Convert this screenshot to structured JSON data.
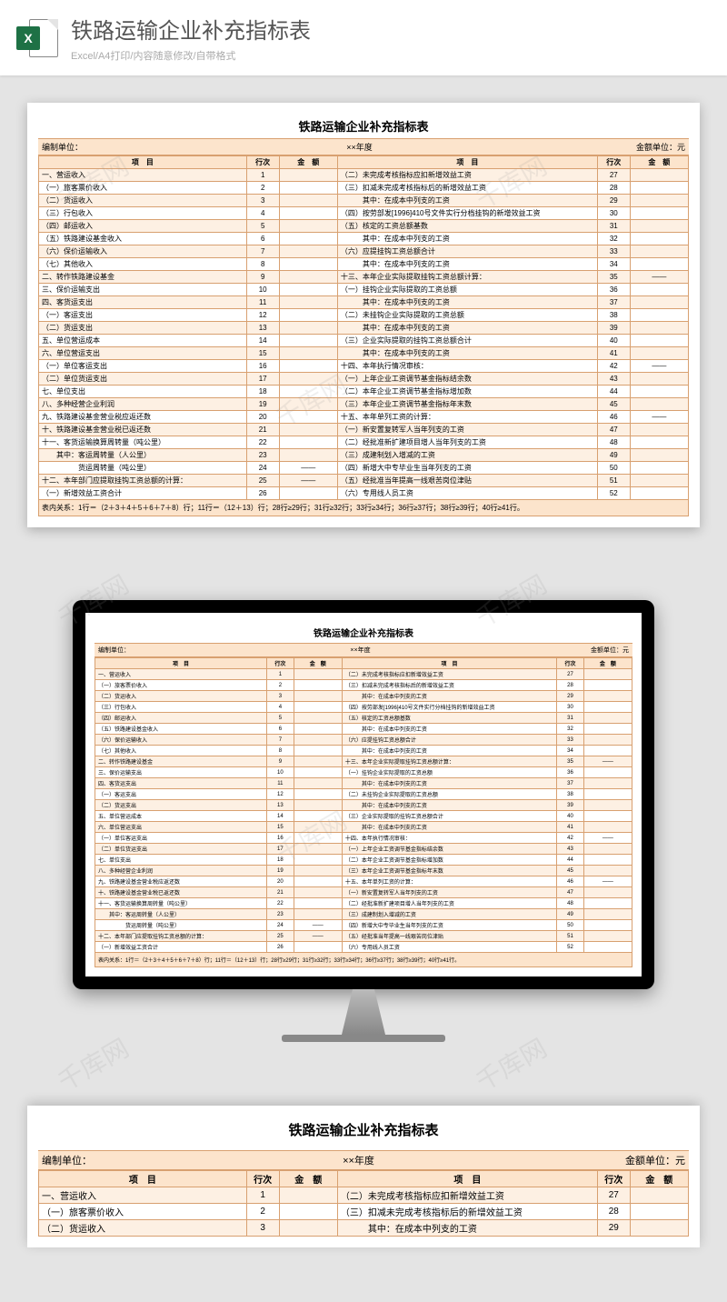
{
  "header": {
    "title": "铁路运输企业补充指标表",
    "subtitle": "Excel/A4打印/内容随意修改/自带格式",
    "icon_letter": "X"
  },
  "sheet": {
    "title": "铁路运输企业补充指标表",
    "meta_left": "编制单位：",
    "meta_mid": "××年度",
    "meta_right": "金额单位：元",
    "col_project": "项　目",
    "col_row": "行次",
    "col_amount": "金　额",
    "note": "表内关系：1行＝（2＋3＋4＋5＋6＋7＋8）行；11行＝（12＋13）行；28行≥29行；31行≥32行；33行≥34行；36行≥37行；38行≥39行；40行≥41行。"
  },
  "rows": [
    {
      "l": "一、营运收入",
      "ln": "1",
      "r": "（二）未完成考核指标应扣新增效益工资",
      "rn": "27"
    },
    {
      "l": "（一）旅客票价收入",
      "ln": "2",
      "r": "（三）扣减未完成考核指标后的新增效益工资",
      "rn": "28"
    },
    {
      "l": "（二）货运收入",
      "ln": "3",
      "r": "　　　其中：在成本中列支的工资",
      "rn": "29"
    },
    {
      "l": "（三）行包收入",
      "ln": "4",
      "r": "（四）按劳部发[1996]410号文件实行分档挂钩的新增效益工资",
      "rn": "30"
    },
    {
      "l": "（四）邮运收入",
      "ln": "5",
      "r": "（五）核定的工资总额基数",
      "rn": "31"
    },
    {
      "l": "（五）铁路建设基金收入",
      "ln": "6",
      "r": "　　　其中：在成本中列支的工资",
      "rn": "32"
    },
    {
      "l": "（六）保价运输收入",
      "ln": "7",
      "r": "（六）应提挂钩工资总额合计",
      "rn": "33"
    },
    {
      "l": "（七）其他收入",
      "ln": "8",
      "r": "　　　其中：在成本中列支的工资",
      "rn": "34"
    },
    {
      "l": "二、转作铁路建设基金",
      "ln": "9",
      "r": "十三、本年企业实际提取挂钩工资总额计算：",
      "rn": "35",
      "ra": "——"
    },
    {
      "l": "三、保价运输支出",
      "ln": "10",
      "r": "（一）挂钩企业实际提取的工资总额",
      "rn": "36"
    },
    {
      "l": "四、客货运支出",
      "ln": "11",
      "r": "　　　其中：在成本中列支的工资",
      "rn": "37"
    },
    {
      "l": "（一）客运支出",
      "ln": "12",
      "r": "（二）未挂钩企业实际提取的工资总额",
      "rn": "38"
    },
    {
      "l": "（二）货运支出",
      "ln": "13",
      "r": "　　　其中：在成本中列支的工资",
      "rn": "39"
    },
    {
      "l": "五、单位营运成本",
      "ln": "14",
      "r": "（三）企业实际提取的挂钩工资总额合计",
      "rn": "40"
    },
    {
      "l": "六、单位营运支出",
      "ln": "15",
      "r": "　　　其中：在成本中列支的工资",
      "rn": "41"
    },
    {
      "l": "（一）单位客运支出",
      "ln": "16",
      "r": "十四、本年执行情况审核：",
      "rn": "42",
      "ra": "——"
    },
    {
      "l": "（二）单位货运支出",
      "ln": "17",
      "r": "（一）上年企业工资调节基金指标结余数",
      "rn": "43"
    },
    {
      "l": "七、单位支出",
      "ln": "18",
      "r": "（二）本年企业工资调节基金指标增加数",
      "rn": "44"
    },
    {
      "l": "八、多种经营企业利润",
      "ln": "19",
      "r": "（三）本年企业工资调节基金指标年末数",
      "rn": "45"
    },
    {
      "l": "九、铁路建设基金营业税应返还数",
      "ln": "20",
      "r": "十五、本年单列工资的计算：",
      "rn": "46",
      "ra": "——"
    },
    {
      "l": "十、铁路建设基金营业税已返还数",
      "ln": "21",
      "r": "（一）新安置复转军人当年列支的工资",
      "rn": "47"
    },
    {
      "l": "十一、客货运输换算周转量（吨公里）",
      "ln": "22",
      "r": "（二）经批准新扩建项目增人当年列支的工资",
      "rn": "48"
    },
    {
      "l": "　　其中：客运周转量（人公里）",
      "ln": "23",
      "r": "（三）成建制划入增减的工资",
      "rn": "49"
    },
    {
      "l": "　　　　　货运周转量（吨公里）",
      "ln": "24",
      "la": "——",
      "r": "（四）新增大中专毕业生当年列支的工资",
      "rn": "50"
    },
    {
      "l": "十二、本年部门应提取挂钩工资总额的计算：",
      "ln": "25",
      "la": "——",
      "r": "（五）经批准当年提高一线艰苦岗位津贴",
      "rn": "51"
    },
    {
      "l": "（一）新增效益工资合计",
      "ln": "26",
      "r": "（六）专用线人员工资",
      "rn": "52"
    }
  ],
  "watermark": "千库网"
}
